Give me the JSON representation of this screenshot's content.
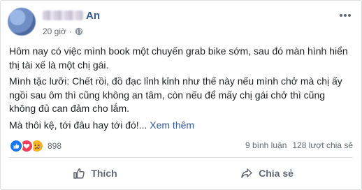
{
  "post": {
    "author_name": "An",
    "timestamp": "20 giờ",
    "privacy_icon": "globe-icon",
    "more_icon": "more-options-icon",
    "paragraphs": [
      "Hôm nay có việc mình book một chuyến grab bike sớm, sau đó màn hình hiển thị tài xế là một chị gái.",
      "Mình tặc lưỡi: Chết rồi, đồ đạc lỉnh kỉnh như thế này nếu mình chở mà chị ấy ngồi sau ôm thì cũng không an tâm, còn nếu để mấy chị gái chở thì cũng không đủ can đảm cho lắm."
    ],
    "last_line": "Mà thôi kệ, tới đâu hay tới đó!...",
    "see_more": "Xem thêm"
  },
  "reactions": {
    "icons": [
      "like-reaction-icon",
      "love-reaction-icon",
      "sad-reaction-icon"
    ],
    "count": "898",
    "comments": "9 bình luận",
    "shares": "128 lượt chia sẻ"
  },
  "actions": {
    "like_label": "Thích",
    "share_label": "Chia sẻ"
  },
  "colors": {
    "link": "#385898",
    "like_blue": "#1877f2",
    "love_red": "#f33e58",
    "haha_yellow": "#f7b125",
    "muted_text": "#606770"
  }
}
